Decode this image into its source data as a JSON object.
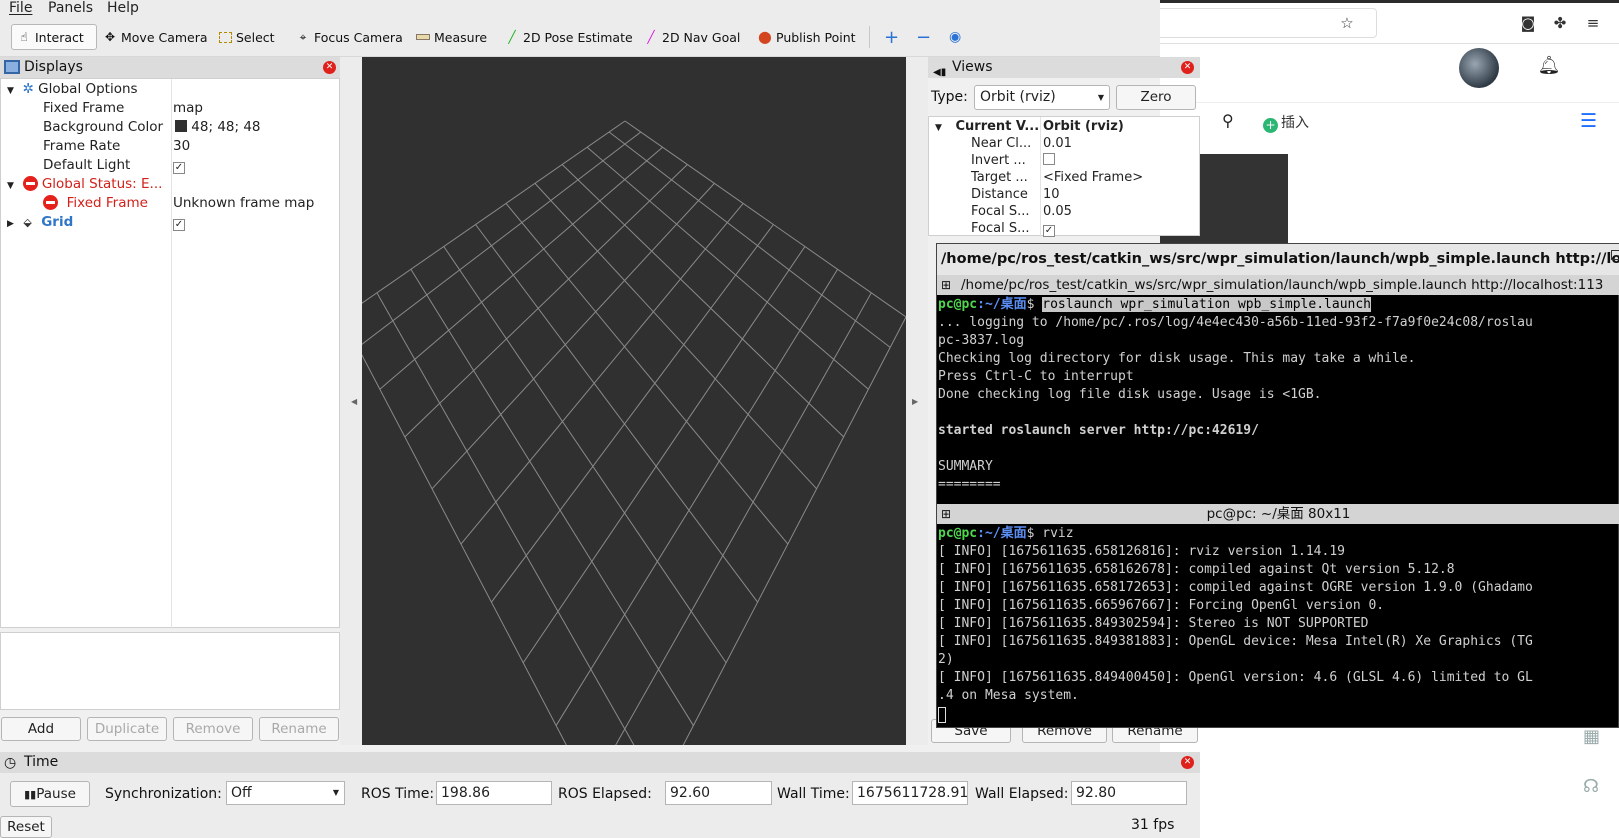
{
  "menubar": {
    "file": "File",
    "panels": "Panels",
    "help": "Help"
  },
  "toolbar": {
    "interact": "Interact",
    "move_camera": "Move Camera",
    "select": "Select",
    "focus_camera": "Focus Camera",
    "measure": "Measure",
    "pose_estimate": "2D Pose Estimate",
    "nav_goal": "2D Nav Goal",
    "publish_point": "Publish Point"
  },
  "displays": {
    "title": "Displays",
    "global_options": "Global Options",
    "fixed_frame_label": "Fixed Frame",
    "fixed_frame_value": "map",
    "bg_color_label": "Background Color",
    "bg_color_value": "48; 48; 48",
    "frame_rate_label": "Frame Rate",
    "frame_rate_value": "30",
    "default_light_label": "Default Light",
    "global_status_label": "Global Status: E...",
    "status_fixed_frame_label": "Fixed Frame",
    "status_fixed_frame_value": "Unknown frame map",
    "grid_label": "Grid",
    "buttons": {
      "add": "Add",
      "duplicate": "Duplicate",
      "remove": "Remove",
      "rename": "Rename"
    }
  },
  "views": {
    "title": "Views",
    "type_label": "Type:",
    "type_value": "Orbit (rviz)",
    "zero": "Zero",
    "rows": [
      {
        "label": "Current V...",
        "value": "Orbit (rviz)"
      },
      {
        "label": "Near Cl...",
        "value": "0.01"
      },
      {
        "label": "Invert ...",
        "value": ""
      },
      {
        "label": "Target ...",
        "value": "<Fixed Frame>"
      },
      {
        "label": "Distance",
        "value": "10"
      },
      {
        "label": "Focal S...",
        "value": "0.05"
      },
      {
        "label": "Focal S...",
        "value": ""
      }
    ],
    "buttons": {
      "save": "Save",
      "remove": "Remove",
      "rename": "Rename"
    }
  },
  "time": {
    "title": "Time",
    "pause": "Pause",
    "sync_label": "Synchronization:",
    "sync_value": "Off",
    "ros_time_label": "ROS Time:",
    "ros_time_value": "198.86",
    "ros_elapsed_label": "ROS Elapsed:",
    "ros_elapsed_value": "92.60",
    "wall_time_label": "Wall Time:",
    "wall_time_value": "1675611728.91",
    "wall_elapsed_label": "Wall Elapsed:",
    "wall_elapsed_value": "92.80",
    "reset": "Reset",
    "fps": "31 fps"
  },
  "terminal": {
    "title": "/home/pc/ros_test/catkin_ws/src/wpr_simulation/launch/wpb_simple.launch http://loc...",
    "tab1": "/home/pc/ros_test/catkin_ws/src/wpr_simulation/launch/wpb_simple.launch http://localhost:113",
    "prompt_user": "pc@pc",
    "prompt_path": ":~/桌面",
    "prompt_sign": "$ ",
    "cmd1": "roslaunch wpr_simulation wpb_simple.launch",
    "out1": [
      "... logging to /home/pc/.ros/log/4e4ec430-a56b-11ed-93f2-f7a9f0e24c08/roslau",
      "pc-3837.log",
      "Checking log directory for disk usage. This may take a while.",
      "Press Ctrl-C to interrupt",
      "Done checking log file disk usage. Usage is <1GB.",
      "",
      "started roslaunch server http://pc:42619/",
      "",
      "SUMMARY",
      "========"
    ],
    "tab2": "pc@pc: ~/桌面 80x11",
    "cmd2": "rviz",
    "out2": [
      "[ INFO] [1675611635.658126816]: rviz version 1.14.19",
      "[ INFO] [1675611635.658162678]: compiled against Qt version 5.12.8",
      "[ INFO] [1675611635.658172653]: compiled against OGRE version 1.9.0 (Ghadamo",
      "[ INFO] [1675611635.665967667]: Forcing OpenGl version 0.",
      "[ INFO] [1675611635.849302594]: Stereo is NOT SUPPORTED",
      "[ INFO] [1675611635.849381883]: OpenGL device: Mesa Intel(R) Xe Graphics (TG",
      "2)",
      "[ INFO] [1675611635.849400450]: OpenGl version: 4.6 (GLSL 4.6) limited to GL",
      ".4 on Mesa system."
    ]
  },
  "browser": {
    "insert": "插入"
  },
  "colors": {
    "viewport_bg": "#303030",
    "error_red": "#e5211b",
    "grid_line": "#8a8a8a",
    "prompt_green": "#4fd64f",
    "prompt_blue": "#5c8ff5"
  }
}
